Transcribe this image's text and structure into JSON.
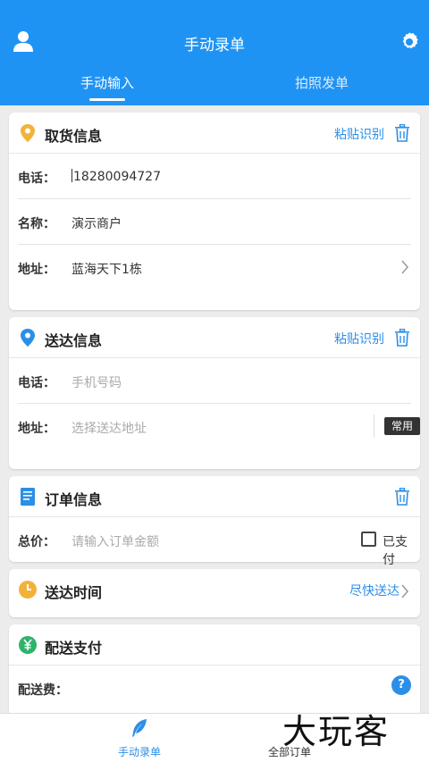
{
  "header": {
    "title": "手动录单",
    "tabs": [
      {
        "label": "手动输入",
        "active": true
      },
      {
        "label": "拍照发单",
        "active": false
      }
    ]
  },
  "pickup": {
    "title": "取货信息",
    "paste_label": "粘贴识别",
    "phone_label": "电话：",
    "phone_value": "18280094727",
    "name_label": "名称：",
    "name_value": "演示商户",
    "address_label": "地址：",
    "address_value": "蓝海天下1栋"
  },
  "delivery": {
    "title": "送达信息",
    "paste_label": "粘贴识别",
    "phone_label": "电话：",
    "phone_placeholder": "手机号码",
    "address_label": "地址：",
    "address_placeholder": "选择送达地址",
    "common_label": "常用"
  },
  "order": {
    "title": "订单信息",
    "total_label": "总价：",
    "total_placeholder": "请输入订单金额",
    "paid_label": "已支付"
  },
  "delivery_time": {
    "title": "送达时间",
    "value": "尽快送达"
  },
  "payment": {
    "title": "配送支付",
    "fee_label": "配送费：",
    "help_glyph": "?"
  },
  "bottom_nav": [
    {
      "label": "手动录单",
      "active": true
    },
    {
      "label": "全部订单",
      "active": false
    }
  ],
  "watermark": "大玩客",
  "colors": {
    "brand_blue": "#1f93f3",
    "link_blue": "#2b8fe8",
    "pickup_pin": "#f2b23a",
    "delivery_pin": "#2b8fe8",
    "time_clock": "#f2b23a",
    "payment_icon": "#2fb36a"
  },
  "icons": {
    "header_left": "user-icon",
    "header_right": "gear-icon",
    "pickup": "location-pin-icon",
    "delivery": "location-pin-icon",
    "order": "document-icon",
    "time": "clock-icon",
    "payment": "yuan-icon",
    "delete": "trash-icon",
    "nav_manual": "feather-icon",
    "nav_orders": "list-icon"
  }
}
